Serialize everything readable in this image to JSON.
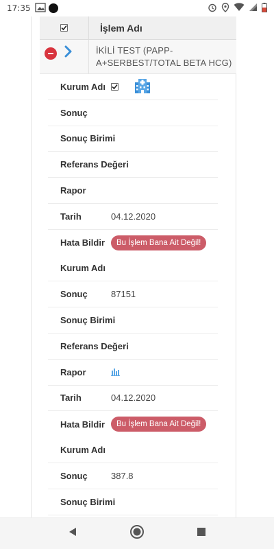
{
  "status_bar": {
    "time": "17:35",
    "left_icons": [
      "gallery-notification-icon",
      "dot-icon"
    ],
    "right_icons": [
      "alarm-icon",
      "location-icon",
      "wifi-icon",
      "signal-icon",
      "battery-icon"
    ]
  },
  "table": {
    "header_title": "İşlem Adı",
    "header_checked": true,
    "item": {
      "name_line1": "İKİLİ TEST (PAPP-",
      "name_line2": "A+SERBEST/TOTAL BETA HCG)"
    }
  },
  "results": [
    {
      "kurum_label": "Kurum Adı",
      "sonuc_label": "Sonuç",
      "sonuc_value": "",
      "birim_label": "Sonuç Birimi",
      "birim_value": "",
      "referans_label": "Referans Değeri",
      "referans_value": "",
      "rapor_label": "Rapor",
      "tarih_label": "Tarih",
      "tarih_value": "04.12.2020",
      "hata_label": "Hata Bildir",
      "hata_button": "Bu İşlem Bana Ait Değil!"
    },
    {
      "kurum_label": "Kurum Adı",
      "sonuc_label": "Sonuç",
      "sonuc_value": "87151",
      "birim_label": "Sonuç Birimi",
      "birim_value": "",
      "referans_label": "Referans Değeri",
      "referans_value": "-",
      "rapor_label": "Rapor",
      "tarih_label": "Tarih",
      "tarih_value": "04.12.2020",
      "hata_label": "Hata Bildir",
      "hata_button": "Bu İşlem Bana Ait Değil!"
    },
    {
      "kurum_label": "Kurum Adı",
      "sonuc_label": "Sonuç",
      "sonuc_value": "387.8",
      "birim_label": "Sonuç Birimi"
    }
  ],
  "colors": {
    "danger_pill": "#cc5c68",
    "minus_button": "#d8343e",
    "chevron": "#3a8fd8",
    "hospital_icon": "#3a8fd8"
  },
  "nav": {
    "back": "back-icon",
    "home": "home-icon",
    "recents": "recents-icon"
  }
}
